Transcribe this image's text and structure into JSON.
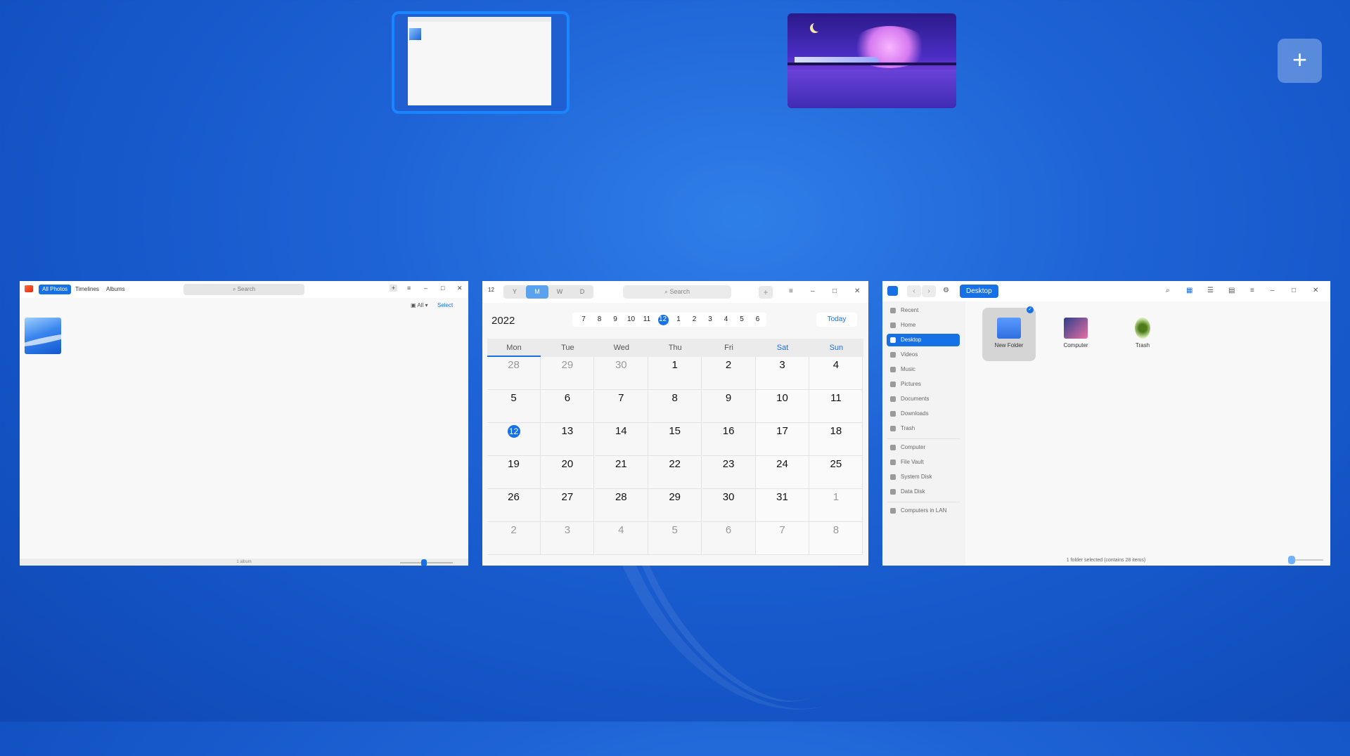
{
  "workspaces": {
    "add_label": "+"
  },
  "photos": {
    "tabs": [
      "All Photos",
      "Timelines",
      "Albums"
    ],
    "search_placeholder": "Search",
    "filter_label": "All",
    "select_label": "Select",
    "status": "1 album"
  },
  "calendar": {
    "views": [
      "Y",
      "M",
      "W",
      "D"
    ],
    "active_view": "M",
    "search_placeholder": "Search",
    "icon_day": "12",
    "year": "2022",
    "strip": [
      "7",
      "8",
      "9",
      "10",
      "11",
      "12",
      "1",
      "2",
      "3",
      "4",
      "5",
      "6"
    ],
    "strip_selected": "12",
    "today_label": "Today",
    "weekdays": [
      "Mon",
      "Tue",
      "Wed",
      "Thu",
      "Fri",
      "Sat",
      "Sun"
    ],
    "weeks": [
      [
        "28",
        "29",
        "30",
        "1",
        "2",
        "3",
        "4"
      ],
      [
        "5",
        "6",
        "7",
        "8",
        "9",
        "10",
        "11"
      ],
      [
        "12",
        "13",
        "14",
        "15",
        "16",
        "17",
        "18"
      ],
      [
        "19",
        "20",
        "21",
        "22",
        "23",
        "24",
        "25"
      ],
      [
        "26",
        "27",
        "28",
        "29",
        "30",
        "31",
        "1"
      ],
      [
        "2",
        "3",
        "4",
        "5",
        "6",
        "7",
        "8"
      ]
    ],
    "selected_day": "12"
  },
  "files": {
    "breadcrumb": "Desktop",
    "sidebar": [
      {
        "label": "Recent"
      },
      {
        "label": "Home"
      },
      {
        "label": "Desktop",
        "active": true
      },
      {
        "label": "Videos"
      },
      {
        "label": "Music"
      },
      {
        "label": "Pictures"
      },
      {
        "label": "Documents"
      },
      {
        "label": "Downloads"
      },
      {
        "label": "Trash"
      },
      {
        "label": "Computer"
      },
      {
        "label": "File Vault"
      },
      {
        "label": "System Disk"
      },
      {
        "label": "Data Disk"
      },
      {
        "label": "Computers in LAN"
      }
    ],
    "items": [
      {
        "label": "New Folder",
        "selected": true,
        "icon": "folder-icon"
      },
      {
        "label": "Computer",
        "icon": "computer-icon"
      },
      {
        "label": "Trash",
        "icon": "trash-icon"
      }
    ],
    "status": "1 folder selected (contains 28 items)"
  }
}
